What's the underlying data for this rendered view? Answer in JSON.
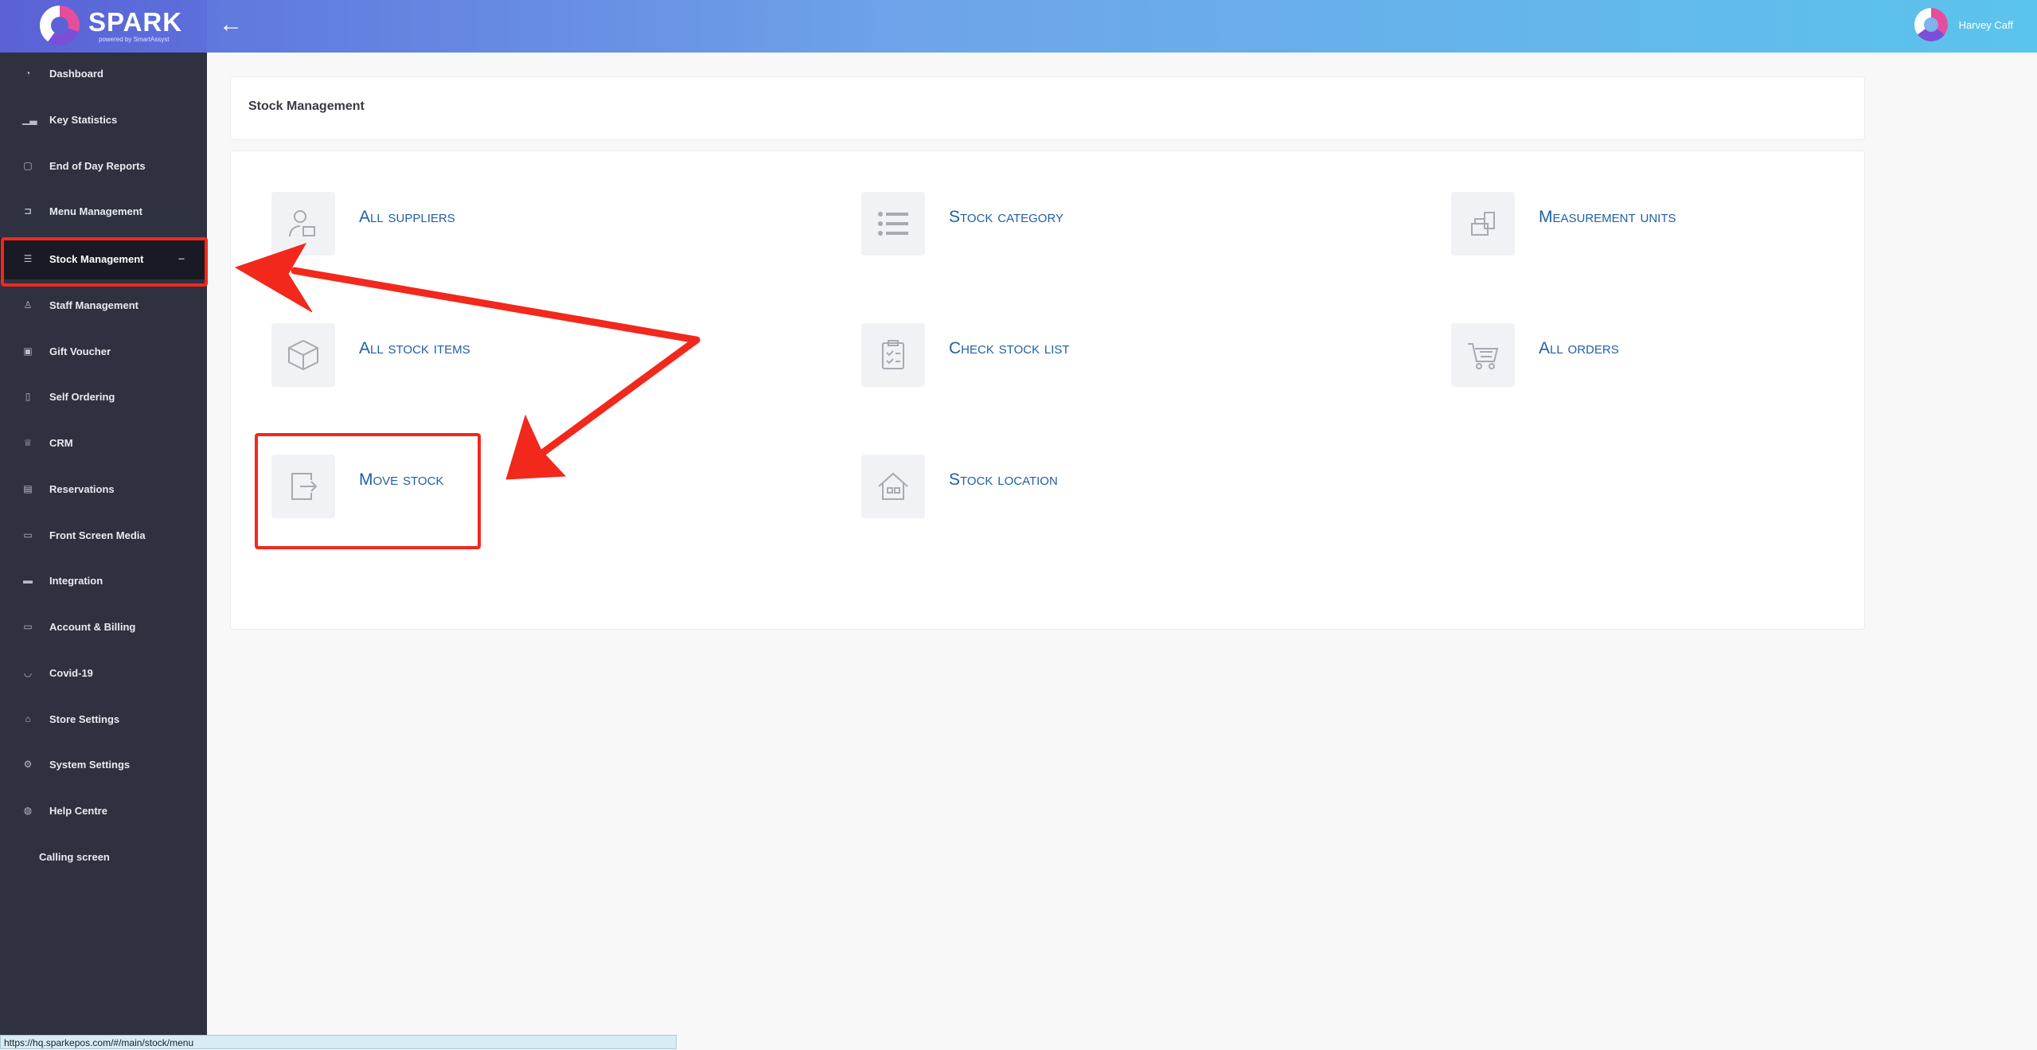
{
  "header": {
    "brand": "SPARK",
    "brand_sub": "powered by SmartAssyst",
    "back_icon": "arrow-left-icon",
    "user_name": "Harvey Caff"
  },
  "sidebar": {
    "items": [
      {
        "label": "Dashboard",
        "icon": "dashboard-icon"
      },
      {
        "label": "Key Statistics",
        "icon": "bar-chart-icon"
      },
      {
        "label": "End of Day Reports",
        "icon": "document-icon"
      },
      {
        "label": "Menu Management",
        "icon": "cart-icon"
      },
      {
        "label": "Stock Management",
        "icon": "database-icon",
        "active": true
      },
      {
        "label": "Staff Management",
        "icon": "person-icon"
      },
      {
        "label": "Gift Voucher",
        "icon": "gift-icon"
      },
      {
        "label": "Self Ordering",
        "icon": "tablet-icon"
      },
      {
        "label": "CRM",
        "icon": "crown-icon"
      },
      {
        "label": "Reservations",
        "icon": "calendar-icon"
      },
      {
        "label": "Front Screen Media",
        "icon": "laptop-icon"
      },
      {
        "label": "Integration",
        "icon": "card-icon"
      },
      {
        "label": "Account & Billing",
        "icon": "wallet-icon"
      },
      {
        "label": "Covid-19",
        "icon": "shield-icon"
      },
      {
        "label": "Store Settings",
        "icon": "home-icon"
      },
      {
        "label": "System Settings",
        "icon": "gear-icon"
      },
      {
        "label": "Help Centre",
        "icon": "globe-icon"
      },
      {
        "label": "Calling screen",
        "icon": ""
      }
    ],
    "active_collapse_symbol": "−"
  },
  "page": {
    "title": "Stock Management"
  },
  "tiles": [
    {
      "label": "All suppliers",
      "icon": "supplier-icon"
    },
    {
      "label": "Stock category",
      "icon": "list-icon"
    },
    {
      "label": "Measurement units",
      "icon": "scale-icon"
    },
    {
      "label": "All stock items",
      "icon": "box-icon"
    },
    {
      "label": "Check stock list",
      "icon": "clipboard-check-icon"
    },
    {
      "label": "All orders",
      "icon": "shopping-cart-icon"
    },
    {
      "label": "Move stock",
      "icon": "move-stock-icon"
    },
    {
      "label": "Stock location",
      "icon": "house-icon"
    }
  ],
  "annotations": {
    "color": "#f2281c"
  },
  "status_bar": {
    "url": "https://hq.sparkepos.com/#/main/stock/menu"
  }
}
